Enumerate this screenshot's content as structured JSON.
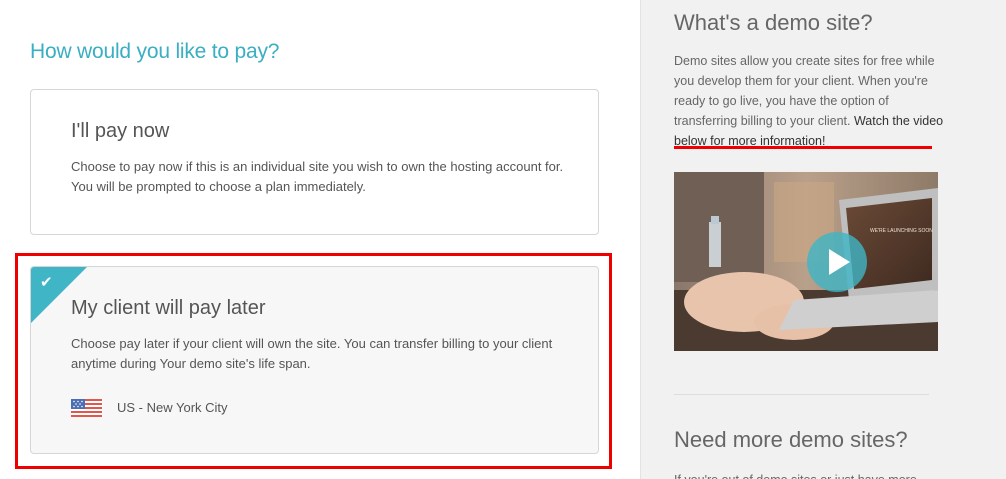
{
  "main": {
    "heading": "How would you like to pay?",
    "options": [
      {
        "title": "I'll pay now",
        "description": "Choose to pay now if this is an individual site you wish to own the hosting account for. You will be prompted to choose a plan immediately.",
        "selected": false
      },
      {
        "title": "My client will pay later",
        "description": "Choose pay later if your client will own the site. You can transfer billing to your client anytime during Your demo site's life span.",
        "selected": true,
        "check_icon": "✔",
        "location": "US - New York City"
      }
    ]
  },
  "sidebar": {
    "demo_title": "What's a demo site?",
    "demo_text": "Demo sites allow you create sites for free while you develop them for your client. When you're ready to go live, you have the option of transferring billing to your client.",
    "video_link": "Watch the video below for more information!",
    "video_screen_text": "WE'RE LAUNCHING SOON",
    "more_title": "Need more demo sites?",
    "more_text": "If you're out of demo sites or just have more"
  },
  "colors": {
    "accent": "#3aaec2",
    "highlight": "#ee0000"
  },
  "icons": {
    "check": "checkmark-icon",
    "flag": "us-flag-icon",
    "play": "play-icon"
  }
}
